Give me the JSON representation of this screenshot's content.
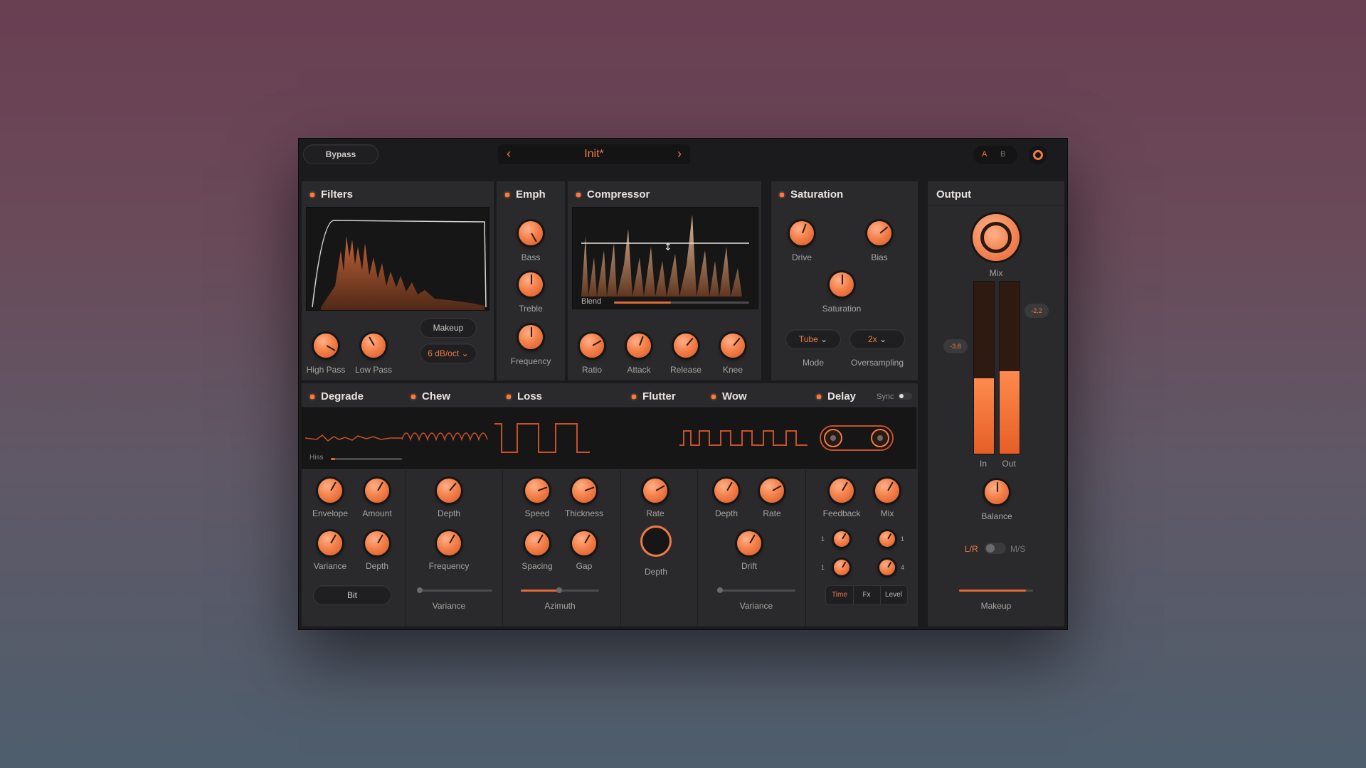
{
  "header": {
    "bypass_label": "Bypass",
    "preset_name": "Init*",
    "prev_icon": "‹",
    "next_icon": "›",
    "toggle_a": "A",
    "toggle_b": "B"
  },
  "filters": {
    "title": "Filters",
    "high_pass": "High Pass",
    "low_pass": "Low Pass",
    "makeup": "Makeup",
    "slope": "6 dB/oct"
  },
  "emph": {
    "title": "Emph",
    "bass": "Bass",
    "treble": "Treble",
    "frequency": "Frequency"
  },
  "compressor": {
    "title": "Compressor",
    "blend": "Blend",
    "blend_level": 0.42,
    "ratio": "Ratio",
    "attack": "Attack",
    "release": "Release",
    "knee": "Knee"
  },
  "saturation": {
    "title": "Saturation",
    "drive": "Drive",
    "bias": "Bias",
    "saturation": "Saturation",
    "mode_value": "Tube",
    "mode_label": "Mode",
    "oversampling_value": "2x",
    "oversampling_label": "Oversampling"
  },
  "output": {
    "title": "Output",
    "mix": "Mix",
    "in": "In",
    "out": "Out",
    "in_level": 0.44,
    "out_level": 0.48,
    "balance": "Balance",
    "lr": "L/R",
    "ms": "M/S",
    "makeup": "Makeup",
    "makeup_level": 0.9,
    "readout_left": "-3.8",
    "readout_right": "-2.2"
  },
  "degrade": {
    "title": "Degrade",
    "hiss": "Hiss",
    "envelope": "Envelope",
    "amount": "Amount",
    "variance": "Variance",
    "depth": "Depth",
    "button": "Bit"
  },
  "chew": {
    "title": "Chew",
    "depth": "Depth",
    "frequency": "Frequency",
    "variance": "Variance"
  },
  "loss": {
    "title": "Loss",
    "speed": "Speed",
    "thickness": "Thickness",
    "spacing": "Spacing",
    "gap": "Gap",
    "azimuth": "Azimuth",
    "azimuth_level": 0.5
  },
  "flutter": {
    "title": "Flutter",
    "rate": "Rate",
    "depth": "Depth"
  },
  "wow": {
    "title": "Wow",
    "depth": "Depth",
    "rate": "Rate",
    "drift": "Drift",
    "variance": "Variance"
  },
  "delay": {
    "title": "Delay",
    "sync": "Sync",
    "feedback": "Feedback",
    "mix": "Mix",
    "tabs": [
      "Time",
      "Fx",
      "Level"
    ],
    "row1_left": "1",
    "row1_right": "1",
    "row2_left": "1",
    "row2_right": "4"
  },
  "colors": {
    "accent": "#f07a43",
    "panel": "#2a2a2c",
    "background": "#1b1b1d"
  }
}
